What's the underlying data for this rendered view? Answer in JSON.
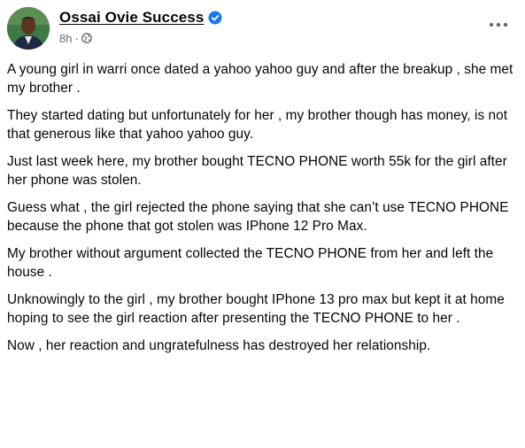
{
  "author": {
    "name": "Ossai Ovie Success",
    "verified_icon": "verified-badge-icon",
    "avatar_icon": "profile-photo"
  },
  "meta": {
    "time": "8h",
    "separator": "·",
    "audience_icon": "globe-icon"
  },
  "menu": {
    "icon": "more-options-icon"
  },
  "colors": {
    "verified_blue": "#1877f2",
    "meta_gray": "#65676b",
    "text": "#050505"
  },
  "post": {
    "paragraphs": [
      "A young girl in warri once dated a yahoo yahoo guy and after the breakup , she met my brother .",
      "They started dating but unfortunately for her , my brother though has money, is not that generous like that yahoo yahoo guy.",
      "Just last week here, my brother bought TECNO PHONE worth 55k for the girl after her phone was stolen.",
      "Guess what , the girl rejected the phone saying that she can’t use TECNO PHONE because the phone that got stolen was IPhone 12 Pro Max.",
      "My brother without argument collected the TECNO PHONE from her and left the house .",
      "Unknowingly to the girl , my brother bought IPhone 13 pro max but kept it at home hoping to see the girl reaction after presenting the TECNO PHONE to her .",
      "Now , her reaction and ungratefulness has destroyed her relationship."
    ]
  }
}
